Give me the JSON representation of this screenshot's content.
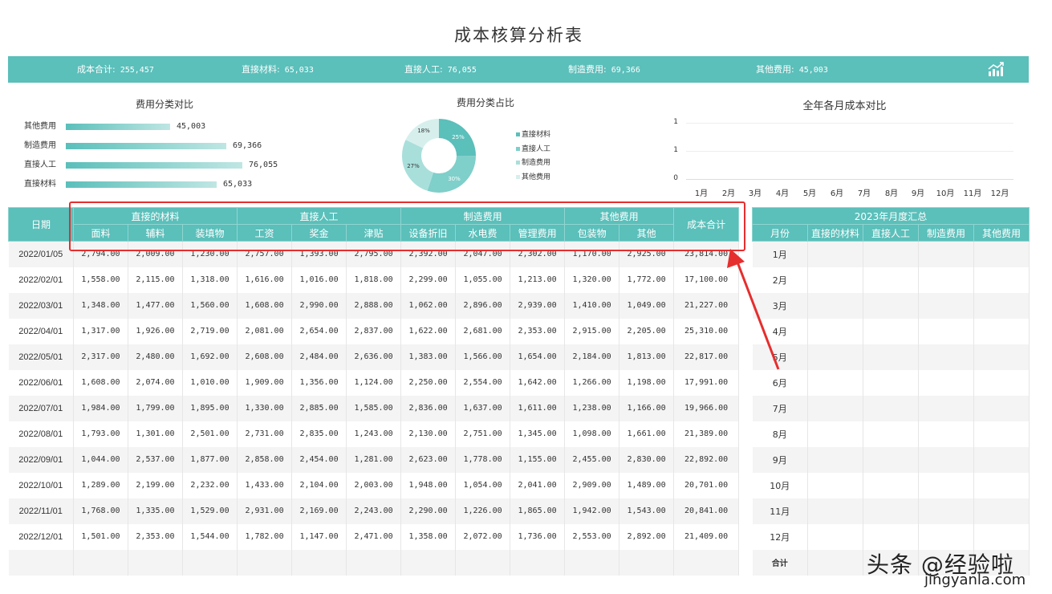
{
  "title": "成本核算分析表",
  "summary": {
    "items": [
      {
        "label": "成本合计:",
        "value": "255,457"
      },
      {
        "label": "直接材料:",
        "value": "65,033"
      },
      {
        "label": "直接人工:",
        "value": "76,055"
      },
      {
        "label": "制造费用:",
        "value": "69,366"
      },
      {
        "label": "其他费用:",
        "value": "45,003"
      }
    ],
    "icon": "trend-chart-icon"
  },
  "bar_panel": {
    "title": "费用分类对比",
    "rows": [
      {
        "label": "其他费用",
        "value": "45,003"
      },
      {
        "label": "制造费用",
        "value": "69,366"
      },
      {
        "label": "直接人工",
        "value": "76,055"
      },
      {
        "label": "直接材料",
        "value": "65,033"
      }
    ]
  },
  "donut_panel": {
    "title": "费用分类占比",
    "slices": [
      {
        "name": "直接材料",
        "pct": "25%",
        "color": "#5bbfba"
      },
      {
        "name": "直接人工",
        "pct": "30%",
        "color": "#7fcfca"
      },
      {
        "name": "制造费用",
        "pct": "27%",
        "color": "#a9dfdb"
      },
      {
        "name": "其他费用",
        "pct": "18%",
        "color": "#d6efed"
      }
    ]
  },
  "line_panel": {
    "title": "全年各月成本对比",
    "y_ticks": [
      "1",
      "1",
      "0"
    ],
    "months": [
      "1月",
      "2月",
      "3月",
      "4月",
      "5月",
      "6月",
      "7月",
      "8月",
      "9月",
      "10月",
      "11月",
      "12月"
    ]
  },
  "main_table": {
    "date_header": "日期",
    "groups": [
      {
        "label": "直接的材料",
        "cols": [
          "面料",
          "辅料",
          "装填物"
        ]
      },
      {
        "label": "直接人工",
        "cols": [
          "工资",
          "奖金",
          "津贴"
        ]
      },
      {
        "label": "制造费用",
        "cols": [
          "设备折旧",
          "水电费",
          "管理费用"
        ]
      },
      {
        "label": "其他费用",
        "cols": [
          "包装物",
          "其他"
        ]
      }
    ],
    "total_header": "成本合计",
    "rows": [
      [
        "2022/01/05",
        "2,794.00",
        "2,009.00",
        "1,230.00",
        "2,757.00",
        "1,393.00",
        "2,795.00",
        "2,392.00",
        "2,047.00",
        "2,302.00",
        "1,170.00",
        "2,925.00",
        "23,814.00"
      ],
      [
        "2022/02/01",
        "1,558.00",
        "2,115.00",
        "1,318.00",
        "1,616.00",
        "1,016.00",
        "1,818.00",
        "2,299.00",
        "1,055.00",
        "1,213.00",
        "1,320.00",
        "1,772.00",
        "17,100.00"
      ],
      [
        "2022/03/01",
        "1,348.00",
        "1,477.00",
        "1,560.00",
        "1,608.00",
        "2,990.00",
        "2,888.00",
        "1,062.00",
        "2,896.00",
        "2,939.00",
        "1,410.00",
        "1,049.00",
        "21,227.00"
      ],
      [
        "2022/04/01",
        "1,317.00",
        "1,926.00",
        "2,719.00",
        "2,081.00",
        "2,654.00",
        "2,837.00",
        "1,622.00",
        "2,681.00",
        "2,353.00",
        "2,915.00",
        "2,205.00",
        "25,310.00"
      ],
      [
        "2022/05/01",
        "2,317.00",
        "2,480.00",
        "1,692.00",
        "2,608.00",
        "2,484.00",
        "2,636.00",
        "1,383.00",
        "1,566.00",
        "1,654.00",
        "2,184.00",
        "1,813.00",
        "22,817.00"
      ],
      [
        "2022/06/01",
        "1,608.00",
        "2,074.00",
        "1,010.00",
        "1,909.00",
        "1,356.00",
        "1,124.00",
        "2,250.00",
        "2,554.00",
        "1,642.00",
        "1,266.00",
        "1,198.00",
        "17,991.00"
      ],
      [
        "2022/07/01",
        "1,984.00",
        "1,799.00",
        "1,895.00",
        "1,330.00",
        "2,885.00",
        "1,585.00",
        "2,836.00",
        "1,637.00",
        "1,611.00",
        "1,238.00",
        "1,166.00",
        "19,966.00"
      ],
      [
        "2022/08/01",
        "1,793.00",
        "1,301.00",
        "2,501.00",
        "2,731.00",
        "2,835.00",
        "1,243.00",
        "2,130.00",
        "2,751.00",
        "1,345.00",
        "1,098.00",
        "1,661.00",
        "21,389.00"
      ],
      [
        "2022/09/01",
        "1,044.00",
        "2,537.00",
        "1,877.00",
        "2,858.00",
        "2,454.00",
        "1,281.00",
        "2,623.00",
        "1,778.00",
        "1,155.00",
        "2,455.00",
        "2,830.00",
        "22,892.00"
      ],
      [
        "2022/10/01",
        "1,289.00",
        "2,199.00",
        "2,232.00",
        "1,433.00",
        "2,104.00",
        "2,003.00",
        "1,948.00",
        "1,054.00",
        "2,041.00",
        "2,909.00",
        "1,489.00",
        "20,701.00"
      ],
      [
        "2022/11/01",
        "1,768.00",
        "1,335.00",
        "1,529.00",
        "2,931.00",
        "2,169.00",
        "2,243.00",
        "2,290.00",
        "1,226.00",
        "1,865.00",
        "1,942.00",
        "1,543.00",
        "20,841.00"
      ],
      [
        "2022/12/01",
        "1,501.00",
        "2,353.00",
        "1,544.00",
        "1,782.00",
        "1,147.00",
        "2,471.00",
        "1,358.00",
        "2,072.00",
        "1,736.00",
        "2,553.00",
        "2,892.00",
        "21,409.00"
      ],
      [
        "",
        "",
        "",
        "",
        "",
        "",
        "",
        "",
        "",
        "",
        "",
        "",
        ""
      ]
    ]
  },
  "side_table": {
    "title": "2023年月度汇总",
    "cols": [
      "月份",
      "直接的材料",
      "直接人工",
      "制造费用",
      "其他费用"
    ],
    "months": [
      "1月",
      "2月",
      "3月",
      "4月",
      "5月",
      "6月",
      "7月",
      "8月",
      "9月",
      "10月",
      "11月",
      "12月"
    ],
    "total_label": "合计"
  },
  "watermark": {
    "main": "头条 @经验啦",
    "sub": "jingyanla.com"
  },
  "colors": {
    "accent": "#5bbfba",
    "highlight": "#e62e2e"
  }
}
